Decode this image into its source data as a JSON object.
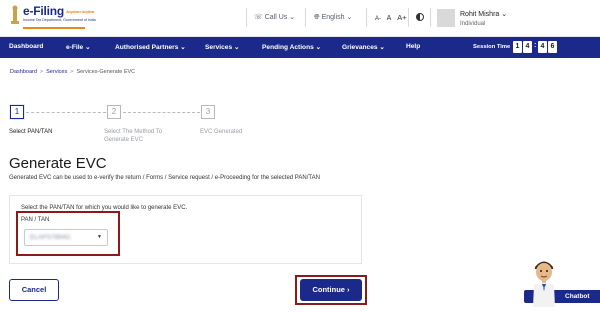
{
  "header": {
    "logo_title": "e-Filing",
    "logo_tagline": "Anywhere Anytime",
    "logo_subtitle": "Income Tax Department, Government of India",
    "call_us": "Call Us",
    "language": "English",
    "font_controls": [
      "A-",
      "A",
      "A+"
    ],
    "user_name": "Rohit Mishra",
    "user_role": "Individual"
  },
  "nav": {
    "items": [
      {
        "label": "Dashboard"
      },
      {
        "label": "e-File"
      },
      {
        "label": "Authorised Partners"
      },
      {
        "label": "Services"
      },
      {
        "label": "Pending Actions"
      },
      {
        "label": "Grievances"
      },
      {
        "label": "Help"
      }
    ],
    "session_label": "Session Time",
    "session_digits": [
      "1",
      "4",
      "4",
      "6"
    ]
  },
  "breadcrumb": [
    "Dashboard",
    "Services",
    "Services-Generate EVC"
  ],
  "stepper": {
    "steps": [
      {
        "number": "1",
        "label": "Select PAN/TAN"
      },
      {
        "number": "2",
        "label": "Select The Method To Generate EVC"
      },
      {
        "number": "3",
        "label": "EVC Generated"
      }
    ]
  },
  "main": {
    "title": "Generate EVC",
    "description": "Generated EVC can be used to e-verify the return / Forms / Service request / e-Proceeding for the selected PAN/TAN",
    "instruction": "Select the PAN/TAN for which you would like to generate EVC.",
    "field_label": "PAN / TAN",
    "field_value": "ELAPS7894G"
  },
  "actions": {
    "cancel": "Cancel",
    "continue": "Continue"
  },
  "chatbot": {
    "label": "Chatbot"
  },
  "colors": {
    "brand_navy": "#1b2a8a",
    "highlight_red": "#8b1a1a",
    "logo_orange": "#e58a1f"
  },
  "icons": [
    "phone-icon",
    "globe-icon",
    "contrast-icon",
    "chevron-down-icon",
    "chevron-right-icon"
  ]
}
